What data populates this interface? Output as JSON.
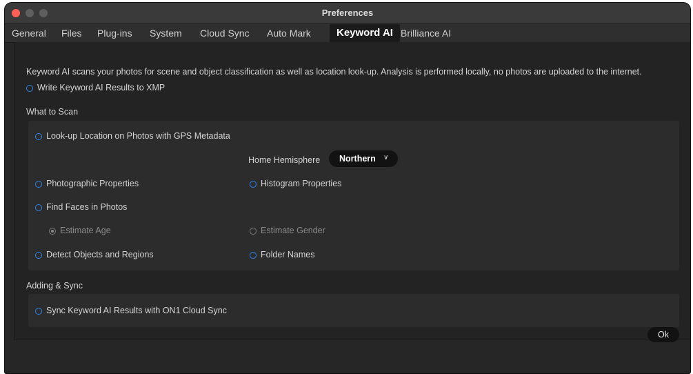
{
  "window": {
    "title": "Preferences"
  },
  "tabs": [
    {
      "label": "General"
    },
    {
      "label": "Files"
    },
    {
      "label": "Plug-ins"
    },
    {
      "label": "System"
    },
    {
      "label": "Cloud Sync"
    },
    {
      "label": "Auto Mark"
    },
    {
      "label": "Keyword AI",
      "active": true
    },
    {
      "label": "Brilliance AI"
    }
  ],
  "intro": "Keyword AI scans your photos for scene and object classification as well as location look-up. Analysis is performed locally, no photos are uploaded to the internet.",
  "write_xmp": {
    "label": "Write Keyword AI Results to XMP"
  },
  "what_to_scan": {
    "heading": "What to Scan",
    "location": "Look-up Location on Photos with GPS Metadata",
    "hemisphere": {
      "label": "Home Hemisphere",
      "value": "Northern"
    },
    "photographic": "Photographic Properties",
    "histogram": "Histogram Properties",
    "faces": "Find Faces in Photos",
    "estimate_age": "Estimate Age",
    "estimate_gender": "Estimate Gender",
    "objects": "Detect Objects and Regions",
    "folders": "Folder Names"
  },
  "adding_sync": {
    "heading": "Adding & Sync",
    "sync": "Sync Keyword AI Results with ON1 Cloud Sync"
  },
  "ok_label": "Ok",
  "colors": {
    "accent": "#2f86ee",
    "close": "#fe5f57"
  }
}
